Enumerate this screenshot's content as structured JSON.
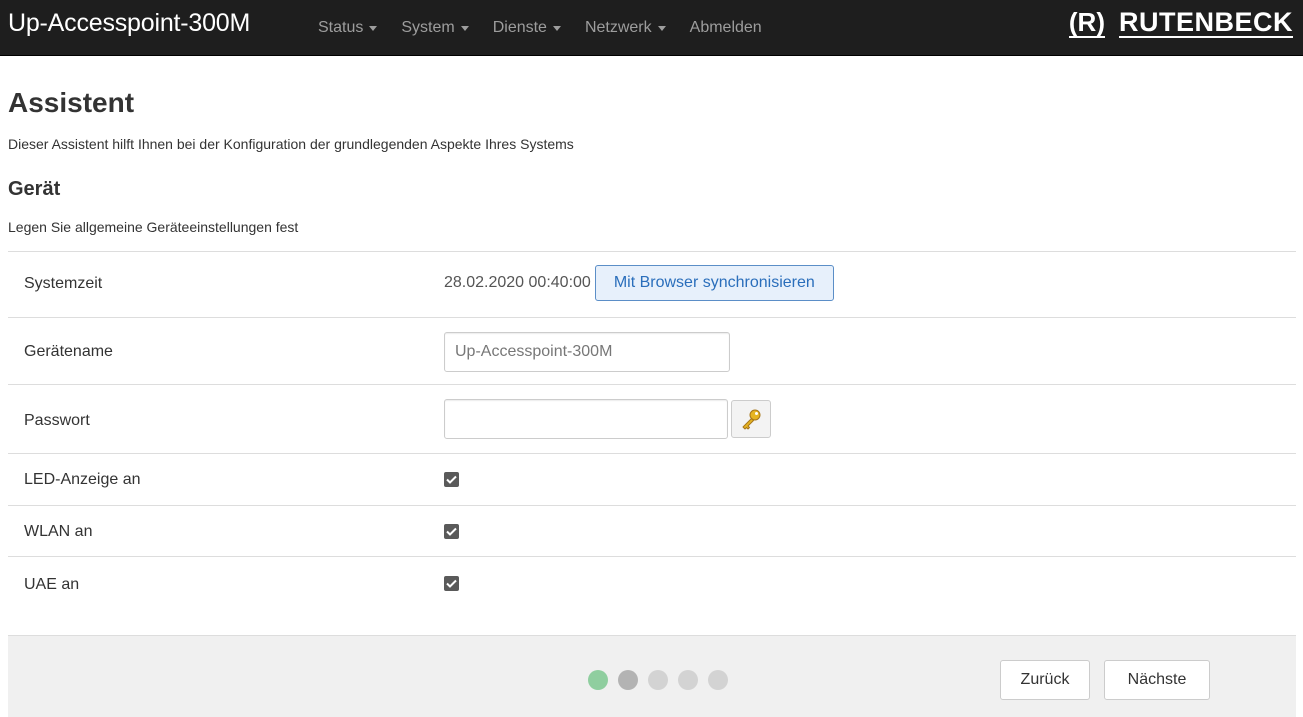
{
  "app": {
    "brand": "Up-Accesspoint-300M",
    "logo_mark": "(R)",
    "logo_text": "RUTENBECK"
  },
  "nav": [
    {
      "label": "Status",
      "dropdown": true
    },
    {
      "label": "System",
      "dropdown": true
    },
    {
      "label": "Dienste",
      "dropdown": true
    },
    {
      "label": "Netzwerk",
      "dropdown": true
    },
    {
      "label": "Abmelden",
      "dropdown": false
    }
  ],
  "page": {
    "title": "Assistent",
    "description": "Dieser Assistent hilft Ihnen bei der Konfiguration der grundlegenden Aspekte Ihres Systems"
  },
  "section": {
    "title": "Gerät",
    "description": "Legen Sie allgemeine Geräteeinstellungen fest"
  },
  "form": {
    "systemzeit": {
      "label": "Systemzeit",
      "value": "28.02.2020 00:40:00",
      "button": "Mit Browser synchronisieren"
    },
    "geraetename": {
      "label": "Gerätename",
      "value": "",
      "placeholder": "Up-Accesspoint-300M"
    },
    "passwort": {
      "label": "Passwort",
      "value": "",
      "reveal_icon": "key-icon"
    },
    "led": {
      "label": "LED-Anzeige an",
      "checked": true
    },
    "wlan": {
      "label": "WLAN an",
      "checked": true
    },
    "uae": {
      "label": "UAE an",
      "checked": true
    }
  },
  "footer": {
    "steps_total": 5,
    "current_step": 1,
    "step_colors": {
      "active": "#8fce9f",
      "inactive": "#c8c8c8",
      "current_secondary": "#b3b3b3"
    },
    "back_label": "Zurück",
    "next_label": "Nächste"
  },
  "colors": {
    "navbar_bg": "#1e1e1e",
    "nav_text": "#9d9d9d",
    "link_blue": "#2a6ebb",
    "checkbox": "#5a5a5a"
  }
}
